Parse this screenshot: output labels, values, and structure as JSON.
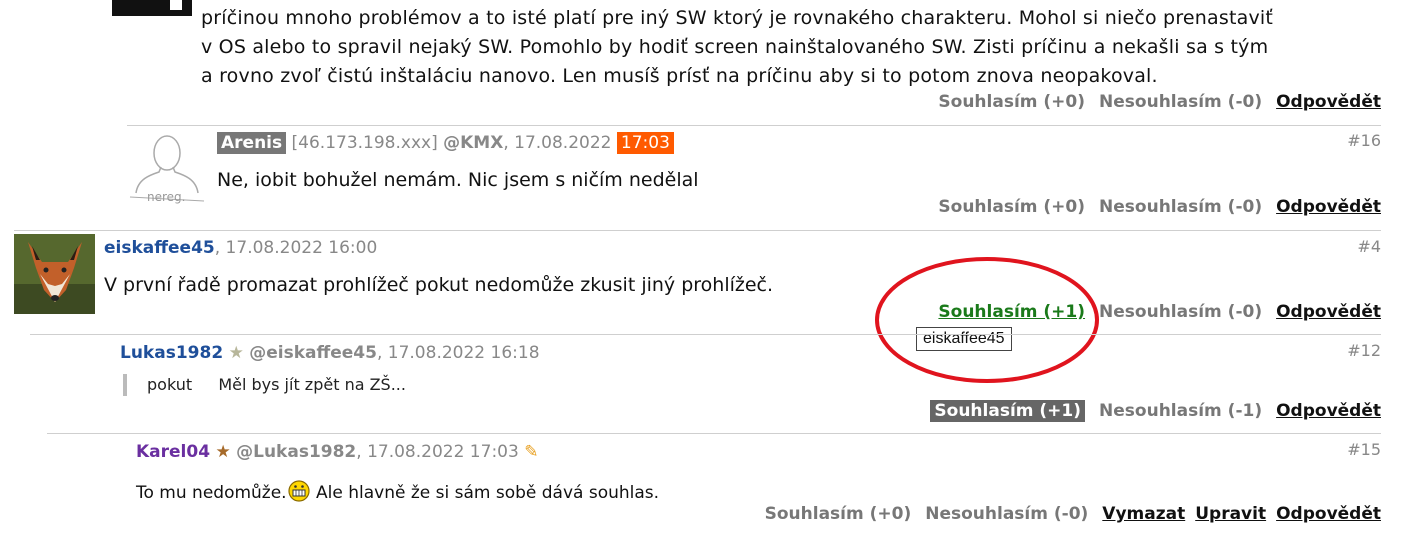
{
  "top_comment": {
    "lines": [
      "príčinou mnoho problémov a to isté platí pre iný SW ktorý je rovnakého charakteru. Mohol si niečo prenastaviť",
      "v OS alebo to spravil nejaký SW. Pomohlo by hodiť screen nainštalovaného SW. Zisti príčinu a nekašli sa s tým",
      "a rovno zvoľ čistú inštaláciu nanovo. Len musíš prísť na príčinu aby si to potom znova neopakoval."
    ],
    "agree": "Souhlasím (+0)",
    "disagree": "Nesouhlasím (-0)",
    "reply": "Odpovědět"
  },
  "c16": {
    "avatar_label": "nereg.",
    "nick": "Arenis",
    "ip": "[46.173.198.xxx]",
    "reply_to": "@KMX",
    "date": ", 17.08.2022",
    "time": "17:03",
    "number": "#16",
    "text": "Ne, iobit bohužel nemám. Nic jsem s ničím nedělal",
    "agree": "Souhlasím (+0)",
    "disagree": "Nesouhlasím (-0)",
    "reply": "Odpovědět"
  },
  "c4": {
    "nick": "eiskaffee45",
    "date": ", 17.08.2022 16:00",
    "number": "#4",
    "text": "V první řadě promazat prohlížeč pokut nedomůže zkusit jiný prohlížeč.",
    "agree": "Souhlasím (+1)",
    "disagree": "Nesouhlasím (-0)",
    "reply": "Odpovědět",
    "tooltip": "eiskaffee45"
  },
  "c12": {
    "nick": "Lukas1982",
    "reply_to": "@eiskaffee45",
    "date": ", 17.08.2022 16:18",
    "number": "#12",
    "quote_label": "pokut",
    "text": "Měl bys jít zpět na ZŠ...",
    "agree": "Souhlasím (+1)",
    "disagree": "Nesouhlasím (-1)",
    "reply": "Odpovědět"
  },
  "c15": {
    "nick": "Karel04",
    "reply_to": "@Lukas1982",
    "date": ", 17.08.2022 17:03",
    "number": "#15",
    "text_before": "To mu nedomůže.",
    "text_after": " Ale hlavně že si sám sobě dává souhlas.",
    "agree": "Souhlasím (+0)",
    "disagree": "Nesouhlasím (-0)",
    "delete": "Vymazat",
    "edit": "Upravit",
    "reply": "Odpovědět"
  },
  "colors": {
    "highlight_circle": "#e0141e",
    "time_badge": "#ff5a00",
    "nick_blue": "#1f4f9a",
    "nick_purple": "#6a2fa0",
    "agree_green": "#1a7a1a"
  }
}
